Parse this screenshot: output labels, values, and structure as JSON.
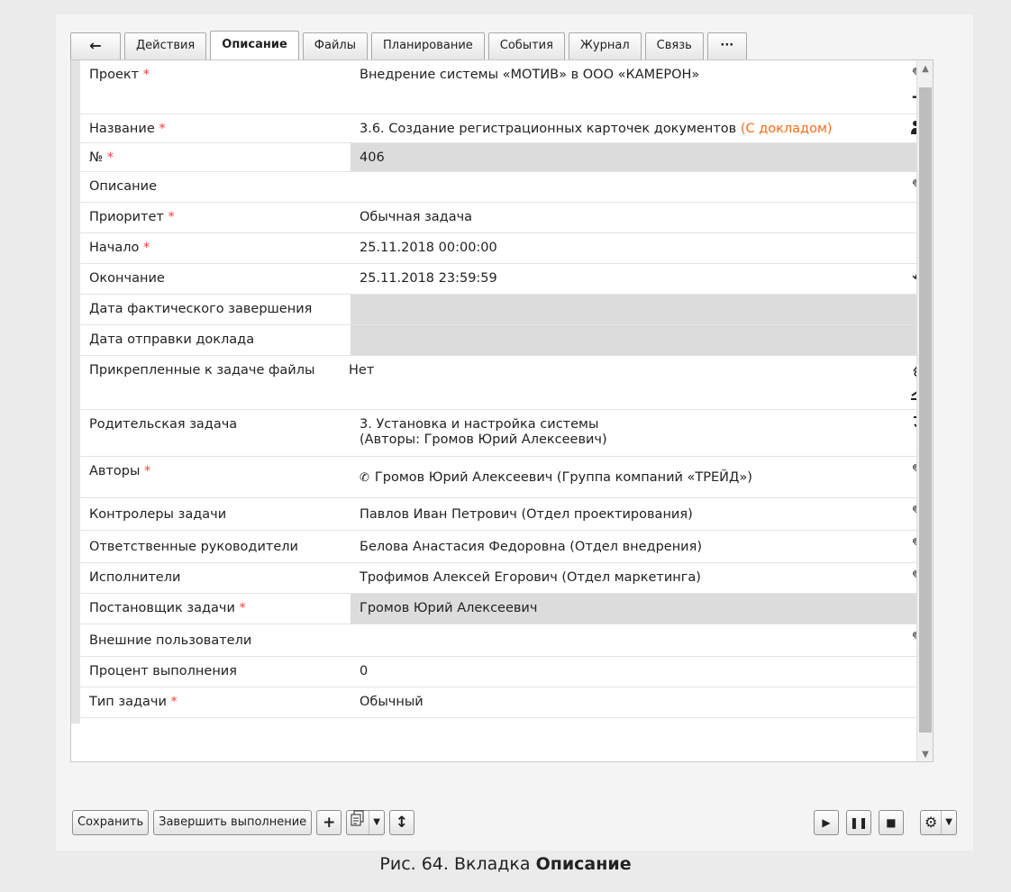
{
  "tabs": [
    {
      "label": "←"
    },
    {
      "label": "Действия"
    },
    {
      "label": "Описание"
    },
    {
      "label": "Файлы"
    },
    {
      "label": "Планирование"
    },
    {
      "label": "События"
    },
    {
      "label": "Журнал"
    },
    {
      "label": "Связь"
    },
    {
      "label": "···"
    }
  ],
  "fields": {
    "project": {
      "label": "Проект",
      "value": "Внедрение системы «МОТИВ» в ООО «КАМЕРОН»"
    },
    "name": {
      "label": "Название",
      "value": "3.6. Создание регистрационных карточек документов",
      "suffix": "(С докладом)"
    },
    "number": {
      "label": "№",
      "value": "406"
    },
    "description": {
      "label": "Описание",
      "value": ""
    },
    "priority": {
      "label": "Приоритет",
      "value": "Обычная задача"
    },
    "start": {
      "label": "Начало",
      "value": "25.11.2018 00:00:00"
    },
    "end": {
      "label": "Окончание",
      "value": "25.11.2018 23:59:59"
    },
    "actual_end": {
      "label": "Дата фактического завершения",
      "value": ""
    },
    "report_date": {
      "label": "Дата отправки доклада",
      "value": ""
    },
    "attached_files": {
      "label": "Прикрепленные к задаче файлы",
      "value": "Нет"
    },
    "parent_task": {
      "label": "Родительская задача",
      "value_line1": "3. Установка и настройка системы",
      "value_line2": "(Авторы: Громов Юрий Алексеевич)"
    },
    "authors": {
      "label": "Авторы",
      "value": "Громов Юрий Алексеевич (Группа компаний «ТРЕЙД»)"
    },
    "controllers": {
      "label": "Контролеры задачи",
      "value": "Павлов Иван Петрович (Отдел проектирования)"
    },
    "managers": {
      "label": "Ответственные руководители",
      "value": "Белова Анастасия Федоровна (Отдел внедрения)"
    },
    "executors": {
      "label": "Исполнители",
      "value": "Трофимов Алексей Егорович (Отдел маркетинга)"
    },
    "assigner": {
      "label": "Постановщик задачи",
      "value": "Громов Юрий Алексеевич"
    },
    "external_users": {
      "label": "Внешние пользователи",
      "value": ""
    },
    "percent": {
      "label": "Процент выполнения",
      "value": "0"
    },
    "task_type": {
      "label": "Тип задачи",
      "value": "Обычный"
    }
  },
  "required_mark": "*",
  "toolbar": {
    "save_label": "Сохранить",
    "finish_label": "Завершить выполнение",
    "add_icon": "plus-icon",
    "copy_icon": "document-copy-icon",
    "expand_icon": "expand-vertical-icon"
  },
  "player": {
    "play_icon": "play-icon",
    "pause_icon": "pause-icon",
    "stop_icon": "stop-icon",
    "settings_icon": "gear-refresh-icon"
  },
  "caption": {
    "prefix": "Рис. 64. Вкладка",
    "bold": "Описание"
  },
  "colors": {
    "required": "#ff3a3a",
    "report_suffix": "#ff6a1a",
    "readonly_bg": "#dcdcdc",
    "active_tab": "Описание"
  }
}
